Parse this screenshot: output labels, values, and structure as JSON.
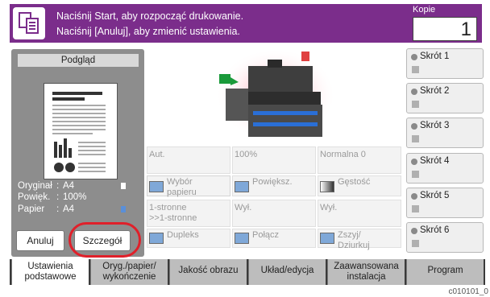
{
  "header": {
    "line1": "Naciśnij Start, aby rozpocząć drukowanie.",
    "line2": "Naciśnij [Anuluj], aby zmienić ustawienia.",
    "copies_label": "Kopie",
    "copies_value": "1"
  },
  "preview": {
    "title": "Podgląd",
    "info": [
      {
        "key": "Oryginał",
        "value": "A4"
      },
      {
        "key": "Powięk.",
        "value": "100%"
      },
      {
        "key": "Papier",
        "value": "A4"
      }
    ],
    "cancel_label": "Anuluj",
    "detail_label": "Szczegół"
  },
  "settings": [
    {
      "value": "Aut.",
      "label": "Wybór\npapieru"
    },
    {
      "value": "100%",
      "label": "Powiększ."
    },
    {
      "value": "Normalna 0",
      "label": "Gęstość"
    },
    {
      "value": "1-stronne\n>>1-stronne",
      "label": "Dupleks"
    },
    {
      "value": "Wył.",
      "label": "Połącz"
    },
    {
      "value": "Wył.",
      "label": "Zszyj/\nDziurkuj"
    }
  ],
  "shortcuts": [
    "Skrót 1",
    "Skrót 2",
    "Skrót 3",
    "Skrót 4",
    "Skrót 5",
    "Skrót 6"
  ],
  "tabs": [
    "Ustawienia\npodstawowe",
    "Oryg./papier/\nwykończenie",
    "Jakość obrazu",
    "Układ/edycja",
    "Zaawansowana\ninstalacja",
    "Program"
  ],
  "footer_code": "c010101_0",
  "colors": {
    "header": "#7b2d8b",
    "highlight_ring": "#e0202a",
    "active_tab": "#ffffff"
  }
}
